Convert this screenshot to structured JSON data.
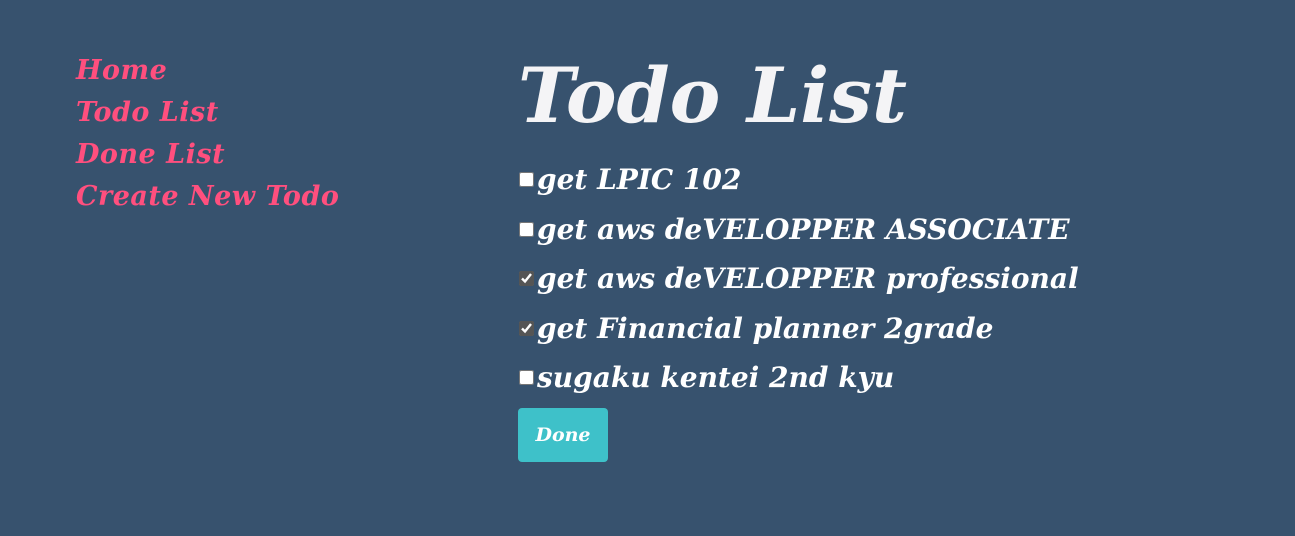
{
  "nav": {
    "items": [
      {
        "label": "Home"
      },
      {
        "label": "Todo List"
      },
      {
        "label": "Done List"
      },
      {
        "label": "Create New Todo"
      }
    ]
  },
  "main": {
    "title": "Todo List",
    "todos": [
      {
        "text": "get LPIC 102",
        "checked": false
      },
      {
        "text": "get aws deVELOPPER ASSOCIATE",
        "checked": false
      },
      {
        "text": "get aws deVELOPPER professional",
        "checked": true
      },
      {
        "text": "get Financial planner 2grade",
        "checked": true
      },
      {
        "text": "sugaku kentei 2nd kyu",
        "checked": false
      }
    ],
    "done_label": "Done"
  },
  "colors": {
    "background": "#37526e",
    "nav_link": "#ff4f7e",
    "title": "#f4f4f6",
    "button": "#3ec1c9"
  }
}
